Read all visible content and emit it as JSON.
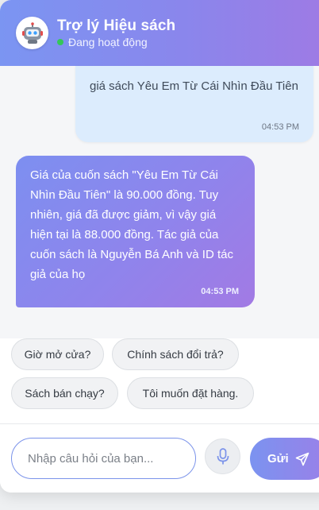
{
  "header": {
    "title": "Trợ lý Hiệu sách",
    "status": "Đang hoạt động",
    "avatar_icon": "robot-icon"
  },
  "messages": [
    {
      "sender": "user",
      "text": "giá sách Yêu Em Từ Cái Nhìn Đầu Tiên",
      "time": "04:53 PM"
    },
    {
      "sender": "bot",
      "text": "Giá của cuốn sách \"Yêu Em Từ Cái Nhìn Đầu Tiên\" là 90.000 đồng. Tuy nhiên, giá đã được giảm, vì vậy giá hiện tại là 88.000 đồng. Tác giả của cuốn sách là Nguyễn Bá Anh và ID tác giả của họ",
      "time": "04:53 PM"
    }
  ],
  "quick_replies": [
    "Giờ mở cửa?",
    "Chính sách đổi trả?",
    "Sách bán chạy?",
    "Tôi muốn đặt hàng."
  ],
  "input": {
    "placeholder": "Nhập câu hỏi của bạn...",
    "value": ""
  },
  "buttons": {
    "send_label": "Gửi",
    "mic_icon": "microphone-icon",
    "send_icon": "paper-plane-icon"
  },
  "colors": {
    "accent_start": "#7b95f2",
    "accent_end": "#a27ae4",
    "user_bubble": "#dcecfd",
    "online_dot": "#34c759"
  }
}
